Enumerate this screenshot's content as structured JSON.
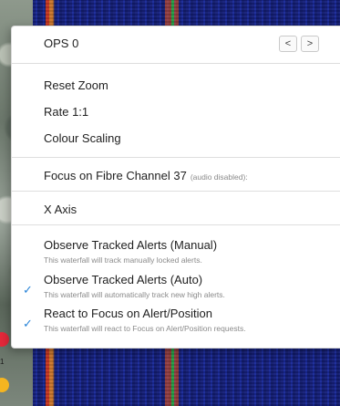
{
  "ops": {
    "label": "OPS 0",
    "prev_icon": "chevron-left-icon",
    "prev_glyph": "<",
    "next_icon": "chevron-right-icon",
    "next_glyph": ">"
  },
  "view_items": {
    "reset_zoom": "Reset Zoom",
    "rate": "Rate 1:1",
    "colour_scaling": "Colour Scaling"
  },
  "focus": {
    "label": "Focus on Fibre Channel 37",
    "note": "(audio disabled):"
  },
  "x_axis": "X Axis",
  "alerts": [
    {
      "label": "Observe Tracked Alerts (Manual)",
      "description": "This waterfall will track manually locked alerts.",
      "checked": false
    },
    {
      "label": "Observe Tracked Alerts (Auto)",
      "description": "This waterfall will automatically track new high alerts.",
      "checked": true
    },
    {
      "label": "React to Focus on Alert/Position",
      "description": "This waterfall will react to Focus on Alert/Position requests.",
      "checked": true
    }
  ],
  "check_glyph": "✓",
  "map_marker_number": "1",
  "colors": {
    "check": "#2a85d8",
    "marker_red": "#e5283a",
    "marker_yellow": "#f5b520",
    "waterfall_bg": "#182585"
  }
}
